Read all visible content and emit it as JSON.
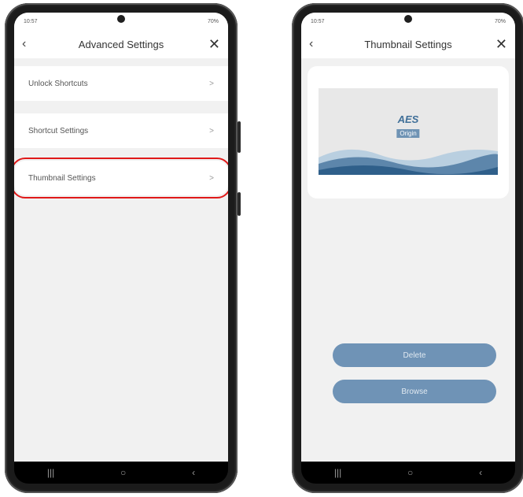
{
  "left": {
    "status_time": "10:57",
    "status_right": "70%",
    "title": "Advanced Settings",
    "back_icon": "‹",
    "close_icon": "✕",
    "items": [
      {
        "label": "Unlock Shortcuts",
        "chevron": ">"
      },
      {
        "label": "Shortcut Settings",
        "chevron": ">"
      },
      {
        "label": "Thumbnail Settings",
        "chevron": ">"
      }
    ]
  },
  "right": {
    "status_time": "10:57",
    "status_right": "70%",
    "title": "Thumbnail Settings",
    "back_icon": "‹",
    "close_icon": "✕",
    "logo_text": "AES",
    "logo_badge": "Origin",
    "buttons": {
      "delete": "Delete",
      "browse": "Browse"
    }
  },
  "navbar": {
    "recents": "|||",
    "home": "○",
    "back": "‹"
  },
  "colors": {
    "highlight": "#e01919",
    "button": "#6f93b6"
  }
}
